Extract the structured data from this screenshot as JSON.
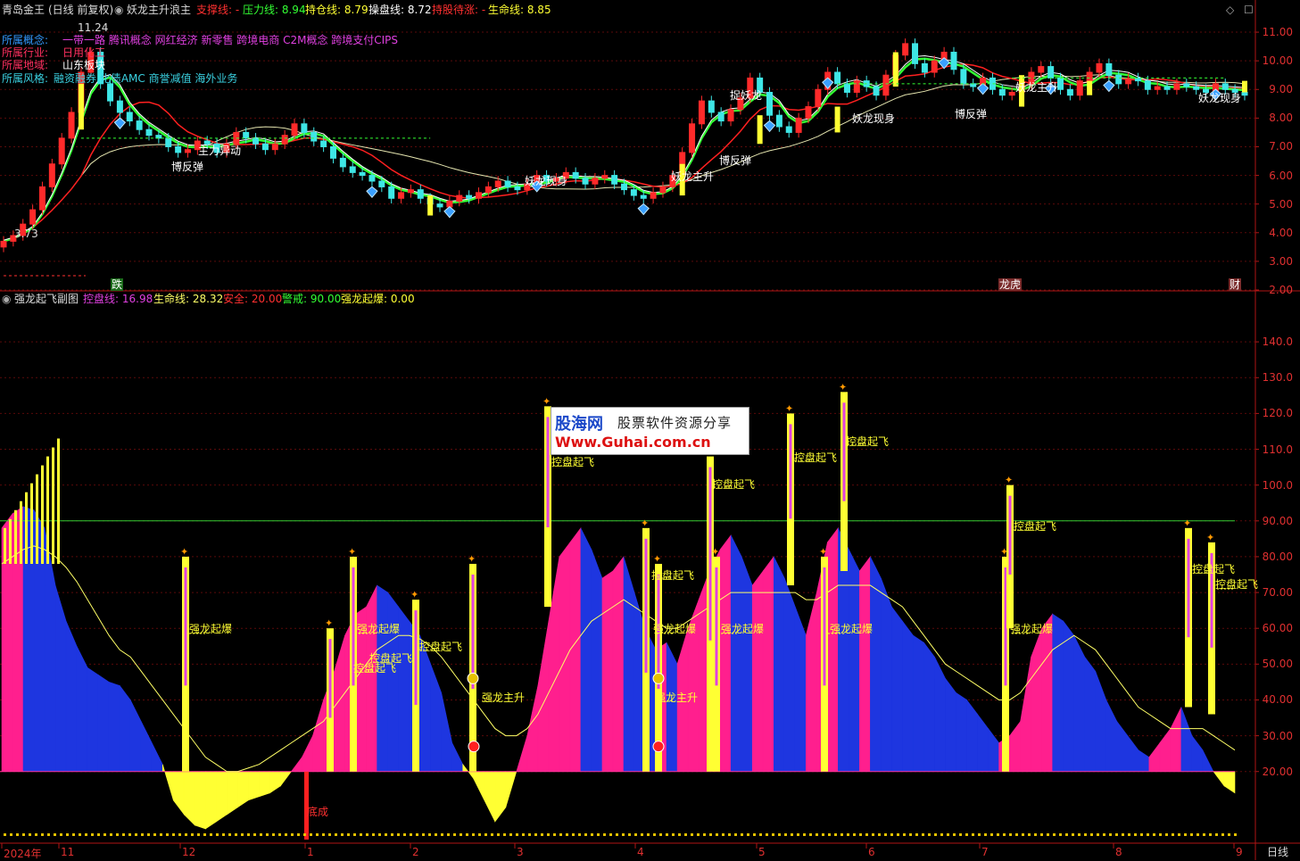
{
  "header": {
    "stock_name": "青岛金王",
    "mode": "(日线 前复权)",
    "indicator_name": "妖龙主升浪主",
    "support_label": "支撑线: -",
    "pressure_label": "压力线: 8.94",
    "hold_label": "持仓线: 8.79",
    "control_label": "操盘线: 8.72",
    "wait_label": "持股待涨: -",
    "life_label": "生命线: 8.85"
  },
  "info": {
    "concept_label": "所属概念:",
    "concept_value": "一带一路 腾讯概念 网红经济 新零售 跨境电商 C2M概念 跨境支付CIPS",
    "industry_label": "所属行业:",
    "industry_value": "日用化工",
    "region_label": "所属地域:",
    "region_value": "山东板块",
    "style_label": "所属风格:",
    "style_value": "融资融券 化债AMC 商誉减值 海外业务"
  },
  "sub_header": {
    "name": "强龙起飞副图",
    "control_line": "控盘线: 16.98",
    "life_line": "生命线: 28.32",
    "safe": "安全: 20.00",
    "alert": "警戒: 90.00",
    "burst": "强龙起爆: 0.00"
  },
  "price_axis": [
    "11.00",
    "10.00",
    "9.00",
    "8.00",
    "7.00",
    "6.00",
    "5.00",
    "4.00",
    "3.00",
    "2.00"
  ],
  "osc_axis": [
    "140.0",
    "130.0",
    "120.0",
    "110.0",
    "100.0",
    "90.00",
    "80.00",
    "70.00",
    "60.00",
    "50.00",
    "40.00",
    "30.00",
    "20.00"
  ],
  "date_axis": [
    "2024年",
    "11",
    "12",
    "1",
    "2",
    "3",
    "4",
    "5",
    "6",
    "7",
    "8",
    "9"
  ],
  "period": "日线",
  "markers": {
    "high": "11.24",
    "low": "3.73",
    "fall": "跌",
    "list": "龙虎",
    "fin": "财"
  },
  "watermark": {
    "brand": "股海网",
    "slogan": "股票软件资源分享",
    "url": "Www.Guhai.com.cn"
  },
  "annotations": {
    "burst": "强龙起爆",
    "takeoff": "控盘起飞",
    "main_rise": "强龙主升",
    "bottom": "底成",
    "rebound": "博反弹",
    "yaolong_appear": "妖龙现身",
    "yaolong_rise": "妖龙主升",
    "main_move": "主力异动",
    "catch": "捉妖龙"
  },
  "chart_data": [
    {
      "type": "candlestick",
      "title": "妖龙主升浪主",
      "ylim": [
        2,
        11.5
      ],
      "close": [
        3.7,
        3.9,
        4.3,
        4.8,
        5.6,
        6.4,
        7.3,
        8.2,
        9.6,
        10.3,
        9.2,
        8.6,
        8.2,
        7.9,
        7.6,
        7.4,
        7.3,
        7.0,
        6.8,
        6.9,
        7.2,
        7.1,
        6.8,
        7.1,
        7.5,
        7.3,
        7.1,
        6.9,
        7.1,
        7.4,
        7.8,
        7.5,
        7.2,
        7.0,
        6.6,
        6.3,
        6.1,
        6.0,
        5.8,
        5.6,
        5.2,
        5.4,
        5.5,
        5.2,
        5.0,
        4.9,
        5.1,
        5.3,
        5.2,
        5.4,
        5.6,
        5.8,
        5.6,
        5.5,
        5.7,
        6.0,
        5.8,
        5.9,
        6.1,
        5.9,
        5.7,
        5.9,
        6.0,
        5.7,
        5.5,
        5.3,
        5.2,
        5.4,
        5.6,
        6.0,
        6.8,
        7.8,
        8.6,
        8.2,
        7.9,
        8.3,
        8.7,
        9.4,
        8.9,
        8.1,
        7.7,
        7.5,
        8.0,
        8.4,
        9.0,
        9.6,
        9.2,
        8.9,
        9.3,
        9.1,
        8.8,
        9.5,
        10.2,
        10.6,
        9.9,
        9.6,
        10.0,
        10.3,
        9.7,
        9.2,
        9.1,
        9.4,
        9.0,
        8.8,
        8.9,
        9.2,
        9.6,
        9.8,
        9.4,
        9.0,
        8.8,
        9.3,
        9.6,
        9.9,
        9.5,
        9.2,
        9.4,
        9.3,
        9.0,
        9.1,
        9.0,
        9.2,
        9.1,
        9.0,
        8.9,
        9.2,
        9.0,
        8.9,
        8.8
      ],
      "price_line_labels": [
        "博反弹",
        "主力异动",
        "妖龙现身",
        "妖龙主升",
        "捉妖龙"
      ]
    },
    {
      "type": "area",
      "title": "强龙起飞副图",
      "ylim": [
        0,
        150
      ],
      "safe_level": 20,
      "alert_level": 90,
      "control_line": [
        88,
        92,
        94,
        93,
        88,
        72,
        62,
        55,
        49,
        47,
        45,
        44,
        40,
        34,
        28,
        22,
        12,
        8,
        5,
        4,
        6,
        8,
        10,
        12,
        13,
        14,
        16,
        20,
        24,
        30,
        40,
        48,
        58,
        64,
        66,
        72,
        70,
        66,
        62,
        58,
        50,
        42,
        28,
        22,
        18,
        12,
        6,
        10,
        20,
        30,
        44,
        62,
        80,
        84,
        88,
        82,
        74,
        76,
        80,
        70,
        60,
        54,
        56,
        50,
        60,
        68,
        76,
        82,
        86,
        80,
        72,
        76,
        80,
        74,
        66,
        58,
        70,
        84,
        88,
        82,
        76,
        80,
        74,
        66,
        62,
        58,
        56,
        52,
        46,
        42,
        40,
        36,
        32,
        28,
        30,
        34,
        52,
        60,
        64,
        62,
        58,
        52,
        48,
        40,
        34,
        30,
        26,
        24,
        28,
        32,
        38,
        30,
        26,
        20,
        16,
        14
      ],
      "life_line": [
        78,
        80,
        82,
        83,
        82,
        80,
        77,
        73,
        68,
        63,
        58,
        54,
        52,
        48,
        44,
        40,
        36,
        32,
        28,
        24,
        22,
        20,
        20,
        21,
        22,
        24,
        26,
        28,
        30,
        32,
        34,
        38,
        42,
        46,
        50,
        54,
        56,
        58,
        58,
        57,
        55,
        52,
        48,
        44,
        40,
        36,
        32,
        30,
        30,
        32,
        36,
        42,
        48,
        54,
        58,
        62,
        64,
        66,
        68,
        66,
        64,
        62,
        60,
        60,
        62,
        64,
        66,
        68,
        70,
        70,
        70,
        70,
        70,
        70,
        70,
        68,
        68,
        70,
        72,
        72,
        72,
        72,
        70,
        68,
        66,
        62,
        58,
        54,
        50,
        48,
        46,
        44,
        42,
        40,
        40,
        42,
        46,
        50,
        54,
        56,
        58,
        56,
        54,
        50,
        46,
        42,
        38,
        36,
        34,
        32,
        32,
        32,
        32,
        30,
        28,
        26
      ],
      "burst_count": 0
    }
  ],
  "colors": {
    "bg": "#000000",
    "grid": "#5a0a0a",
    "border": "#b01515",
    "up": "#ff2a2a",
    "down": "#3ee6e6",
    "yellow": "#ffff33",
    "magenta": "#ff1f8e",
    "blue": "#1e36e0",
    "pale": "#ffff7a"
  }
}
